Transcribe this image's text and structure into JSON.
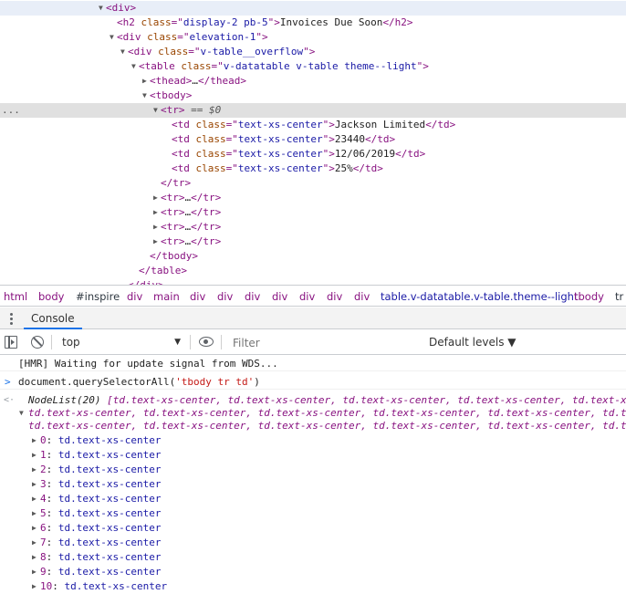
{
  "elements": {
    "lines": [
      {
        "indent": 108,
        "tri": "▼",
        "open": "div",
        "attrs": [],
        "tail": "",
        "highlight": "top"
      },
      {
        "indent": 120,
        "tri": "",
        "open": "h2",
        "attrs": [
          {
            "n": "class",
            "v": "display-2 pb-5"
          }
        ],
        "text": "Invoices Due Soon",
        "close": "h2"
      },
      {
        "indent": 120,
        "tri": "▼",
        "open": "div",
        "attrs": [
          {
            "n": "class",
            "v": "elevation-1"
          }
        ]
      },
      {
        "indent": 132,
        "tri": "▼",
        "open": "div",
        "attrs": [
          {
            "n": "class",
            "v": "v-table__overflow"
          }
        ]
      },
      {
        "indent": 144,
        "tri": "▼",
        "open": "table",
        "attrs": [
          {
            "n": "class",
            "v": "v-datatable v-table theme--light"
          }
        ]
      },
      {
        "indent": 156,
        "tri": "▶",
        "open": "thead",
        "attrs": [],
        "text": "…",
        "close": "thead"
      },
      {
        "indent": 156,
        "tri": "▼",
        "open": "tbody",
        "attrs": []
      },
      {
        "indent": 168,
        "tri": "▼",
        "open": "tr",
        "attrs": [],
        "suffix": " == $0",
        "highlight": "selected"
      },
      {
        "indent": 180,
        "tri": "",
        "open": "td",
        "attrs": [
          {
            "n": "class",
            "v": "text-xs-center"
          }
        ],
        "text": "Jackson Limited",
        "close": "td"
      },
      {
        "indent": 180,
        "tri": "",
        "open": "td",
        "attrs": [
          {
            "n": "class",
            "v": "text-xs-center"
          }
        ],
        "text": "23440",
        "close": "td"
      },
      {
        "indent": 180,
        "tri": "",
        "open": "td",
        "attrs": [
          {
            "n": "class",
            "v": "text-xs-center"
          }
        ],
        "text": "12/06/2019",
        "close": "td"
      },
      {
        "indent": 180,
        "tri": "",
        "open": "td",
        "attrs": [
          {
            "n": "class",
            "v": "text-xs-center"
          }
        ],
        "text": "25%",
        "close": "td"
      },
      {
        "indent": 168,
        "tri": "",
        "closeOnly": "tr"
      },
      {
        "indent": 168,
        "tri": "▶",
        "open": "tr",
        "attrs": [],
        "text": "…",
        "close": "tr"
      },
      {
        "indent": 168,
        "tri": "▶",
        "open": "tr",
        "attrs": [],
        "text": "…",
        "close": "tr"
      },
      {
        "indent": 168,
        "tri": "▶",
        "open": "tr",
        "attrs": [],
        "text": "…",
        "close": "tr"
      },
      {
        "indent": 168,
        "tri": "▶",
        "open": "tr",
        "attrs": [],
        "text": "…",
        "close": "tr"
      },
      {
        "indent": 156,
        "tri": "",
        "closeOnly": "tbody"
      },
      {
        "indent": 144,
        "tri": "",
        "closeOnly": "table"
      },
      {
        "indent": 132,
        "tri": "",
        "closeOnly": "div"
      }
    ],
    "selected_marker": "..."
  },
  "breadcrumbs": [
    {
      "label": "html",
      "kind": "tag"
    },
    {
      "label": "body",
      "kind": "tag"
    },
    {
      "label": "#inspire",
      "kind": "plain"
    },
    {
      "label": "div",
      "kind": "tag"
    },
    {
      "label": "main",
      "kind": "tag"
    },
    {
      "label": "div",
      "kind": "tag"
    },
    {
      "label": "div",
      "kind": "tag"
    },
    {
      "label": "div",
      "kind": "tag"
    },
    {
      "label": "div",
      "kind": "tag"
    },
    {
      "label": "div",
      "kind": "tag"
    },
    {
      "label": "div",
      "kind": "tag"
    },
    {
      "label": "div",
      "kind": "tag"
    },
    {
      "label": "table.v-datatable.v-table.theme--light",
      "kind": "cls"
    },
    {
      "label": "tbody",
      "kind": "tag"
    },
    {
      "label": "tr",
      "kind": "plain"
    }
  ],
  "console_tab": {
    "label": "Console"
  },
  "toolbar": {
    "context": "top",
    "filter_placeholder": "Filter",
    "levels": "Default levels ▼"
  },
  "console": {
    "hmr": "[HMR] Waiting for update signal from WDS...",
    "command_prefix": "document.querySelectorAll(",
    "command_arg": "'tbody tr td'",
    "command_suffix": ")",
    "result_head": "NodeList(20)",
    "result_line1": "[td.text-xs-center, td.text-xs-center, td.text-xs-center, td.text-xs-center, td.text-x",
    "result_line2": "td.text-xs-center, td.text-xs-center, td.text-xs-center, td.text-xs-center, td.text-xs-center, td.t",
    "result_line3": "td.text-xs-center, td.text-xs-center, td.text-xs-center, td.text-xs-center, td.text-xs-center, td.t",
    "items": [
      {
        "index": "0",
        "value": "td.text-xs-center"
      },
      {
        "index": "1",
        "value": "td.text-xs-center"
      },
      {
        "index": "2",
        "value": "td.text-xs-center"
      },
      {
        "index": "3",
        "value": "td.text-xs-center"
      },
      {
        "index": "4",
        "value": "td.text-xs-center"
      },
      {
        "index": "5",
        "value": "td.text-xs-center"
      },
      {
        "index": "6",
        "value": "td.text-xs-center"
      },
      {
        "index": "7",
        "value": "td.text-xs-center"
      },
      {
        "index": "8",
        "value": "td.text-xs-center"
      },
      {
        "index": "9",
        "value": "td.text-xs-center"
      },
      {
        "index": "10",
        "value": "td.text-xs-center"
      }
    ]
  },
  "colors": {
    "tag": "#881280",
    "attr": "#994500",
    "value": "#1a1aa6",
    "selected_row": "#e0e0e0",
    "tab_underline": "#1a73e8"
  }
}
